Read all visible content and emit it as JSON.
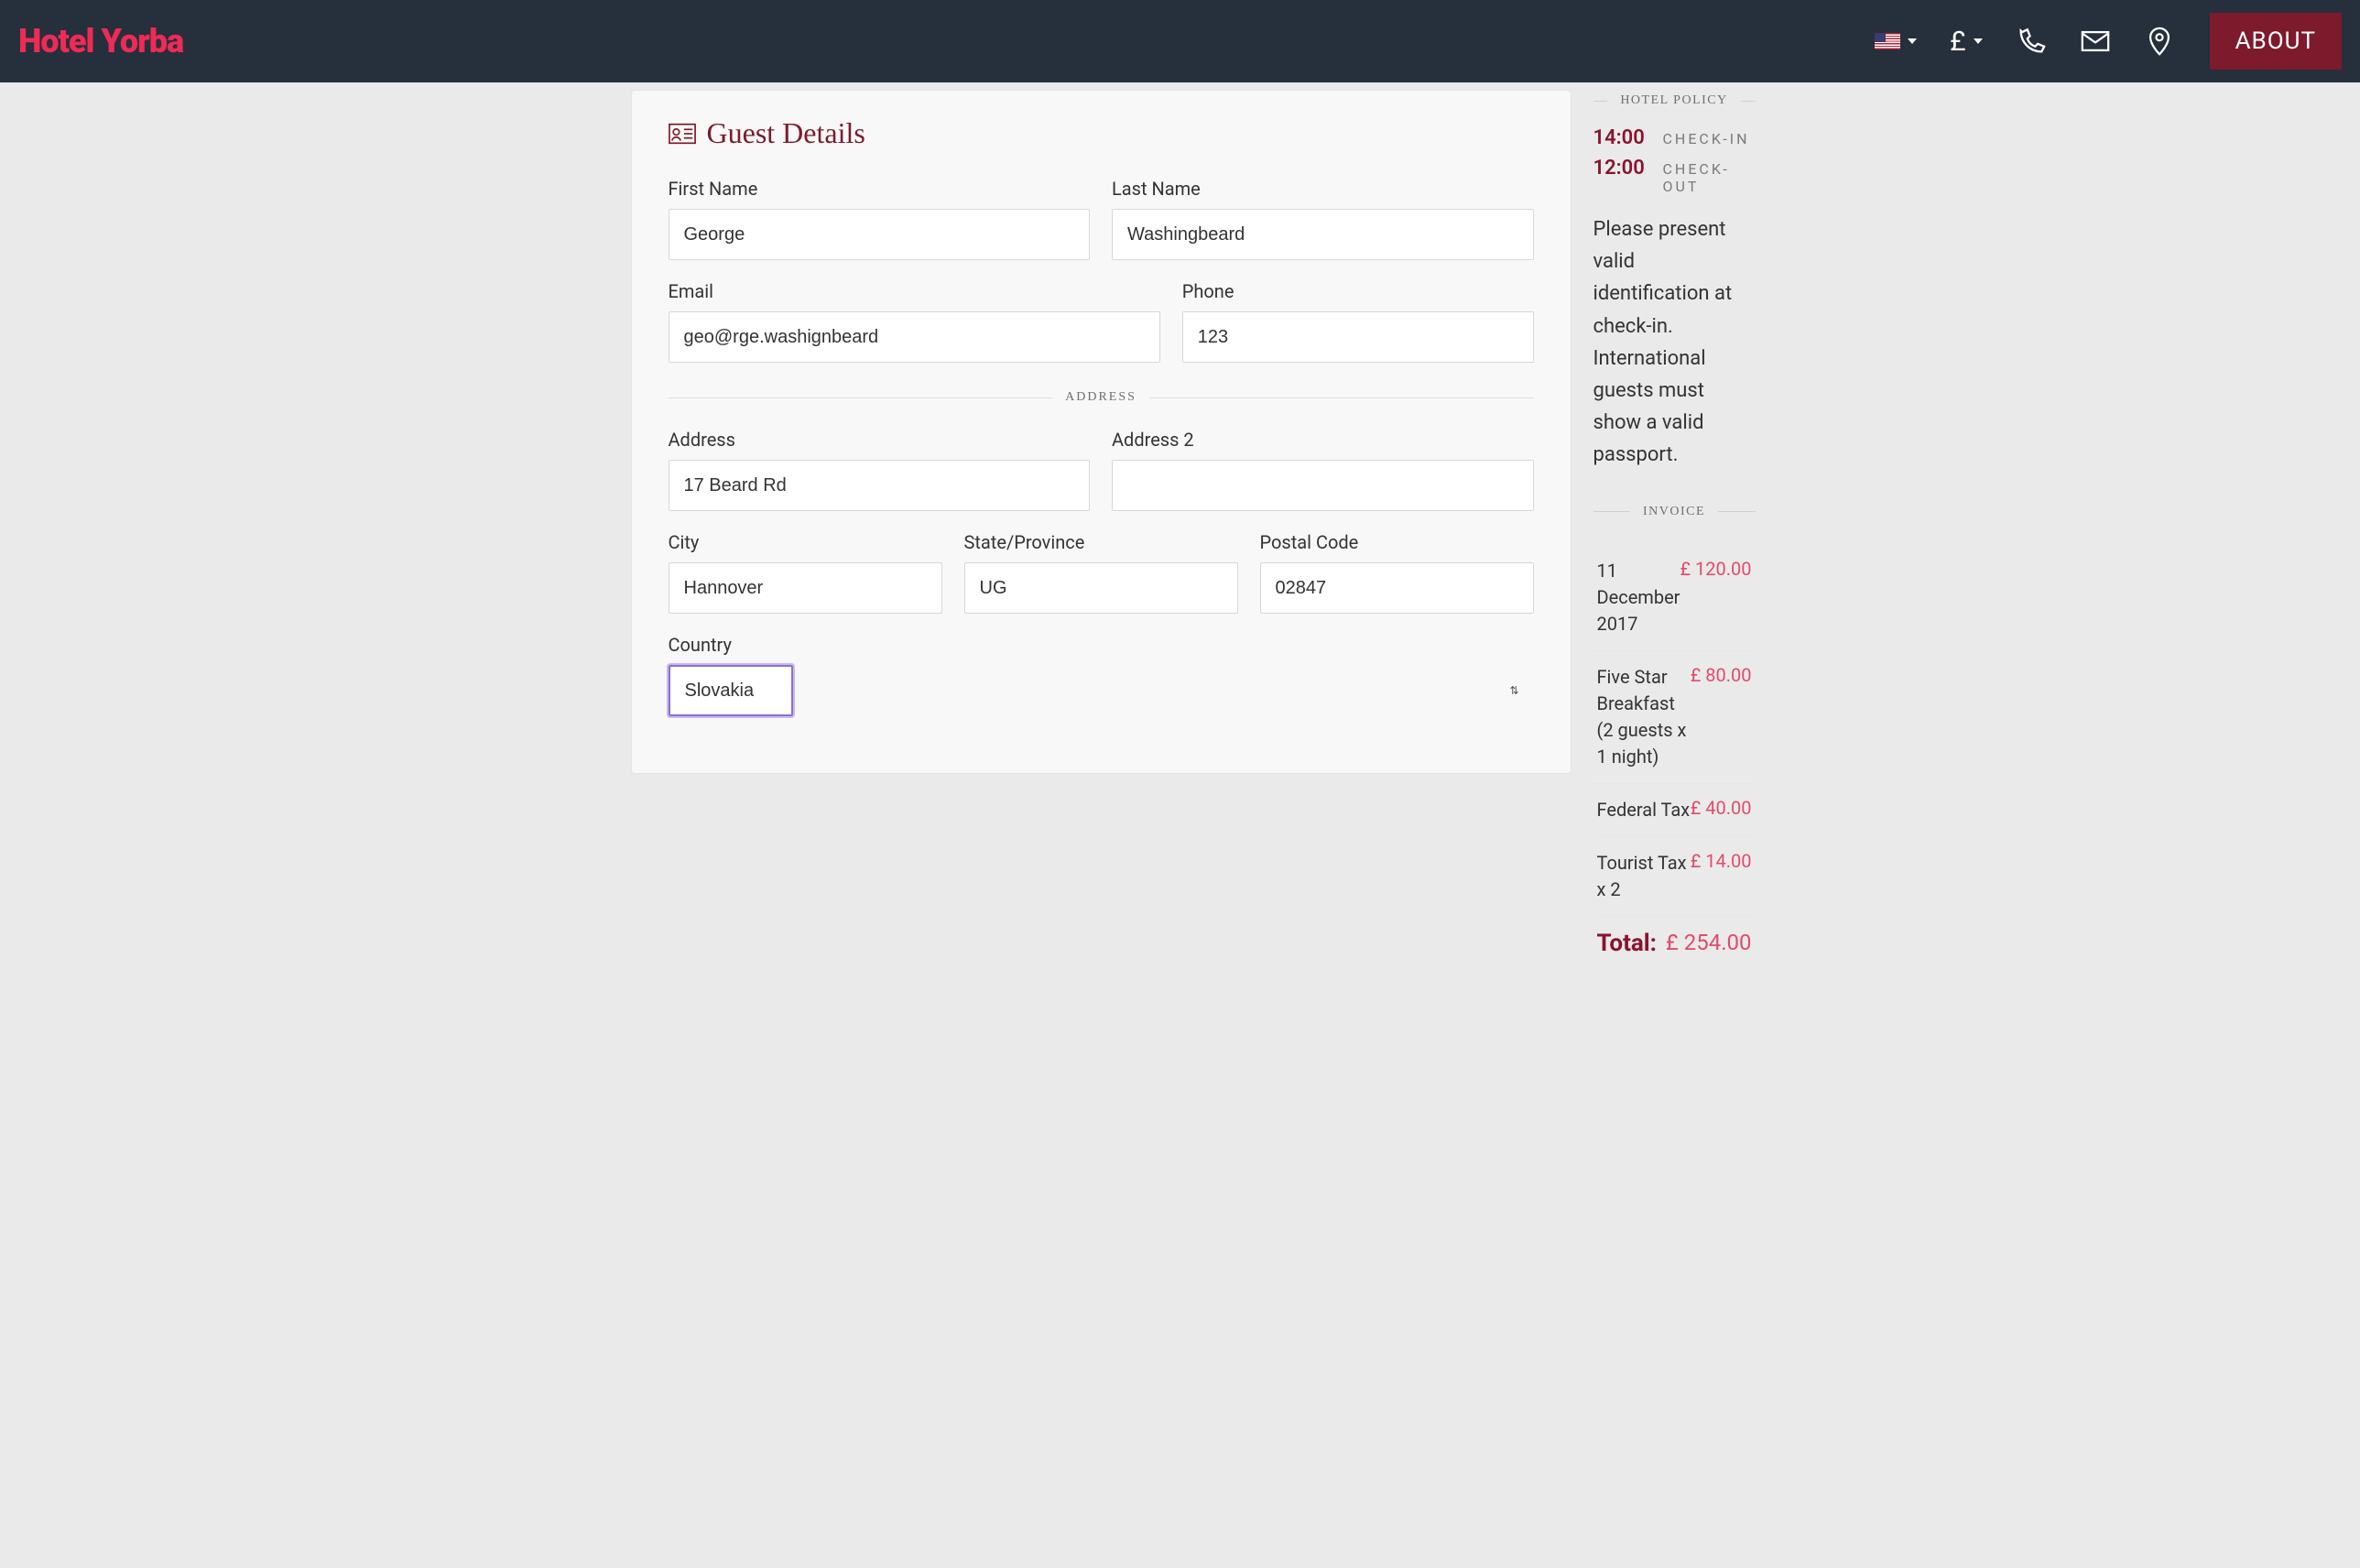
{
  "header": {
    "logo": "Hotel Yorba",
    "currency_symbol": "£",
    "about_label": "ABOUT"
  },
  "guest_details": {
    "section_title": "Guest Details",
    "first_name_label": "First Name",
    "first_name_value": "George",
    "last_name_label": "Last Name",
    "last_name_value": "Washingbeard",
    "email_label": "Email",
    "email_value": "geo@rge.washignbeard",
    "phone_label": "Phone",
    "phone_value": "123",
    "address_section_label": "ADDRESS",
    "address_label": "Address",
    "address_value": "17 Beard Rd",
    "address2_label": "Address 2",
    "address2_value": "",
    "city_label": "City",
    "city_value": "Hannover",
    "state_label": "State/Province",
    "state_value": "UG",
    "postal_label": "Postal Code",
    "postal_value": "02847",
    "country_label": "Country",
    "country_value": "Slovakia"
  },
  "policy": {
    "section_label": "HOTEL POLICY",
    "checkin_time": "14:00",
    "checkin_label": "CHECK-IN",
    "checkout_time": "12:00",
    "checkout_label": "CHECK-OUT",
    "text": "Please present valid identification at check-in. International guests must show a valid passport."
  },
  "invoice": {
    "section_label": "INVOICE",
    "items": [
      {
        "desc": "11 December 2017",
        "price": "£ 120.00"
      },
      {
        "desc": "Five Star Breakfast (2 guests x 1 night)",
        "price": "£ 80.00"
      },
      {
        "desc": "Federal Tax",
        "price": "£ 40.00"
      },
      {
        "desc": "Tourist Tax x 2",
        "price": "£ 14.00"
      }
    ],
    "total_label": "Total:",
    "total_price": "£ 254.00"
  }
}
